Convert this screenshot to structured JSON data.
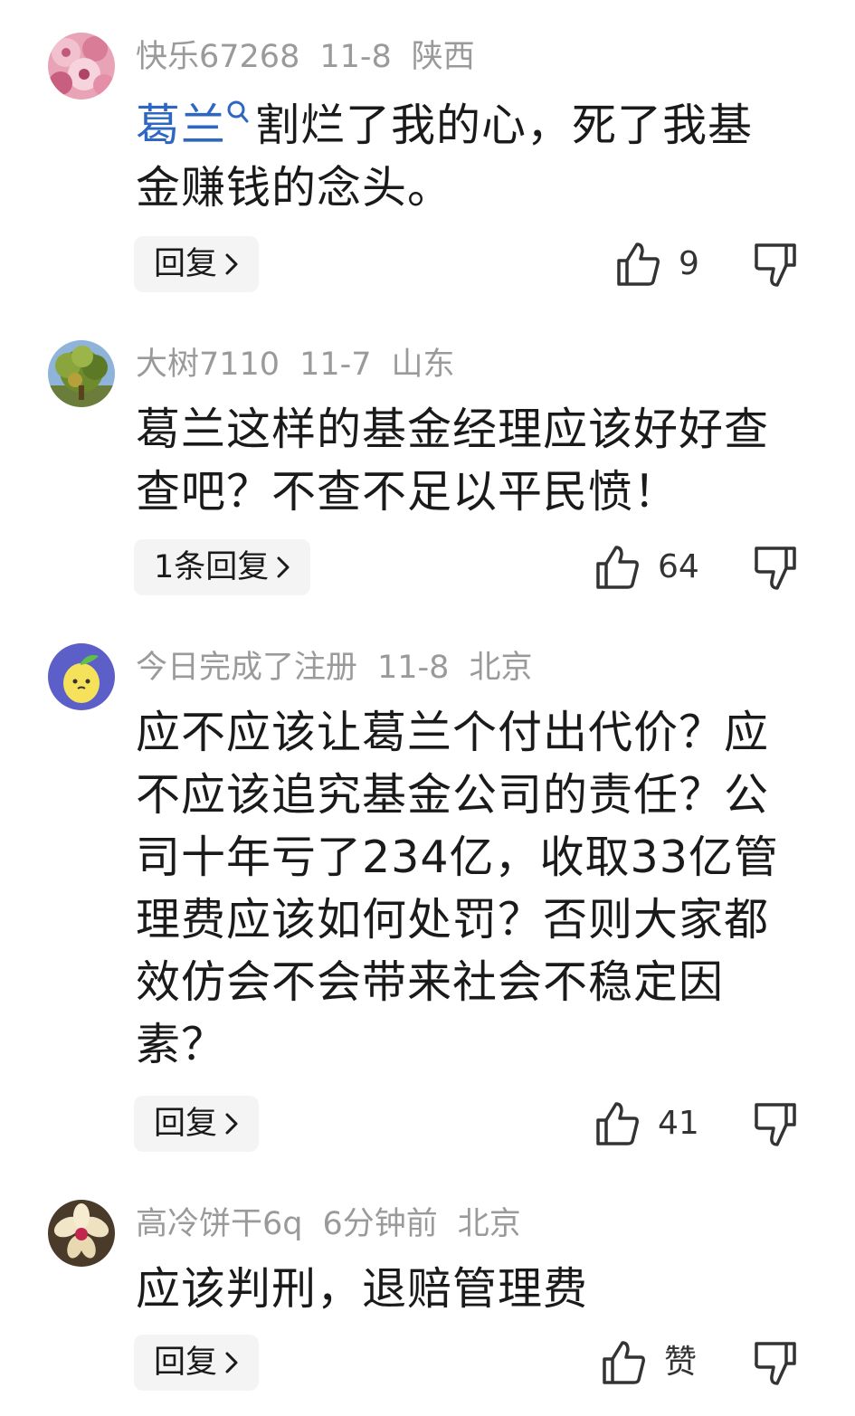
{
  "comments": [
    {
      "username": "快乐67268",
      "date": "11-8",
      "location": "陕西",
      "mention": "葛兰",
      "text": "割烂了我的心，死了我基金赚钱的念头。",
      "reply_label": "回复",
      "likes": "9",
      "avatar": "pink-flowers-avatar"
    },
    {
      "username": "大树7110",
      "date": "11-7",
      "location": "山东",
      "text": "葛兰这样的基金经理应该好好查查吧？不查不足以平民愤！",
      "reply_label": "1条回复",
      "likes": "64",
      "avatar": "tree-avatar"
    },
    {
      "username": "今日完成了注册",
      "date": "11-8",
      "location": "北京",
      "text": "应不应该让葛兰个付出代价？应不应该追究基金公司的责任？公司十年亏了234亿，收取33亿管理费应该如何处罚？否则大家都效仿会不会带来社会不稳定因素？",
      "reply_label": "回复",
      "likes": "41",
      "avatar": "lemon-cartoon-avatar"
    },
    {
      "username": "高冷饼干6q",
      "date": "6分钟前",
      "location": "北京",
      "text": "应该判刑，退赔管理费",
      "reply_label": "回复",
      "likes": "赞",
      "avatar": "orchid-flower-avatar"
    }
  ],
  "colors": {
    "link": "#2e67c2",
    "meta": "#9a9a9a",
    "reply_bg": "#f4f4f4"
  },
  "icons": {
    "like": "thumbs-up-icon",
    "dislike": "thumbs-down-icon",
    "chevron": "chevron-right-icon",
    "search": "search-icon"
  }
}
